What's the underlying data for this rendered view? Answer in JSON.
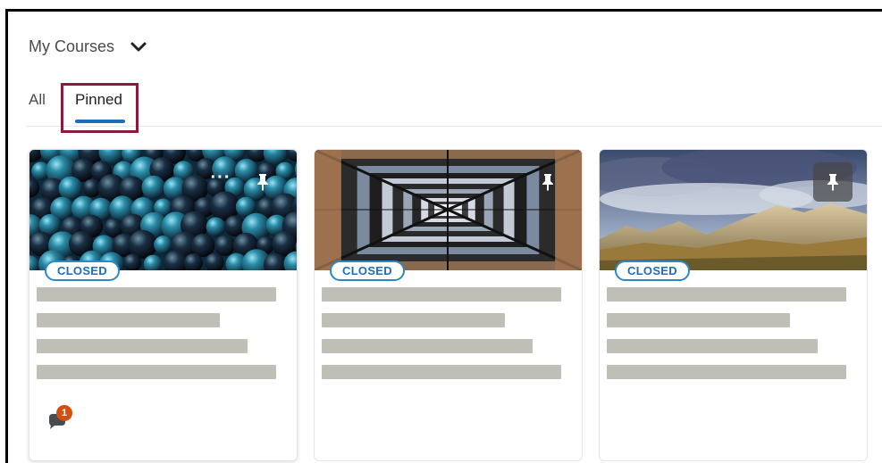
{
  "header": {
    "title": "My Courses",
    "chevron_icon": "chevron-down-icon"
  },
  "tabs": [
    {
      "label": "All",
      "selected": false
    },
    {
      "label": "Pinned",
      "selected": true
    }
  ],
  "colors": {
    "accent": "#1c6dba",
    "highlight_box": "#8b1a3c",
    "placeholder": "#bfbfb8",
    "notification": "#d34f0f"
  },
  "courses": [
    {
      "status": "CLOSED",
      "image": "blue-glass-spheres",
      "pinned": true,
      "notification_icon": "discussion-icon",
      "notification_count": "1"
    },
    {
      "status": "CLOSED",
      "image": "geometric-tunnel",
      "pinned": true
    },
    {
      "status": "CLOSED",
      "image": "mountain-landscape",
      "pinned": true
    }
  ]
}
